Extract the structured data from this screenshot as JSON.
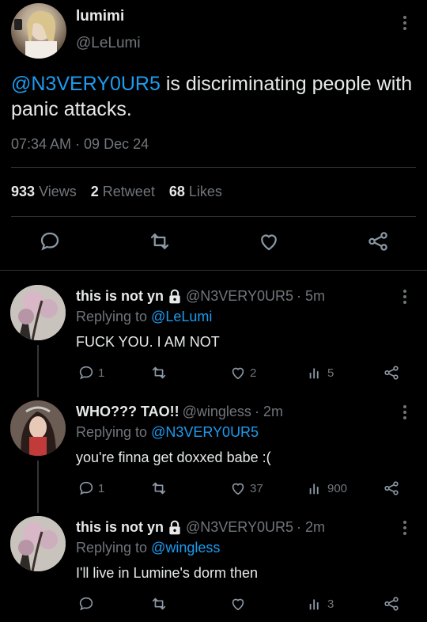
{
  "main_tweet": {
    "display_name": "lumimi",
    "handle": "@LeLumi",
    "mention": "@N3VERY0UR5",
    "text": " is discriminating people with panic attacks.",
    "timestamp": "07:34 AM · 09 Dec 24",
    "stats": {
      "views_count": "933",
      "views_label": "Views",
      "retweets_count": "2",
      "retweets_label": "Retweet",
      "likes_count": "68",
      "likes_label": "Likes"
    }
  },
  "replies": [
    {
      "display_name": "this is not yn",
      "handle": "@N3VERY0UR5",
      "time": "· 5m",
      "replying_prefix": "Replying to",
      "replying_to": "@LeLumi",
      "text": "FUCK YOU. I AM NOT",
      "replies": "1",
      "retweets": "",
      "likes": "2",
      "views": "5"
    },
    {
      "display_name": "WHO??? TAO!!",
      "handle": "@wingless",
      "time": "· 2m",
      "replying_prefix": "Replying to",
      "replying_to": "@N3VERY0UR5",
      "text": "you're finna get doxxed babe :(",
      "replies": "1",
      "retweets": "",
      "likes": "37",
      "views": "900"
    },
    {
      "display_name": "this is not yn",
      "handle": "@N3VERY0UR5",
      "time": "· 2m",
      "replying_prefix": "Replying to",
      "replying_to": "@wingless",
      "text": "I'll live in Lumine's dorm then",
      "replies": "",
      "retweets": "",
      "likes": "",
      "views": "3"
    }
  ],
  "colors": {
    "background": "#000000",
    "link": "#1d9bf0",
    "muted": "#71767b",
    "text": "#e7e9ea"
  }
}
